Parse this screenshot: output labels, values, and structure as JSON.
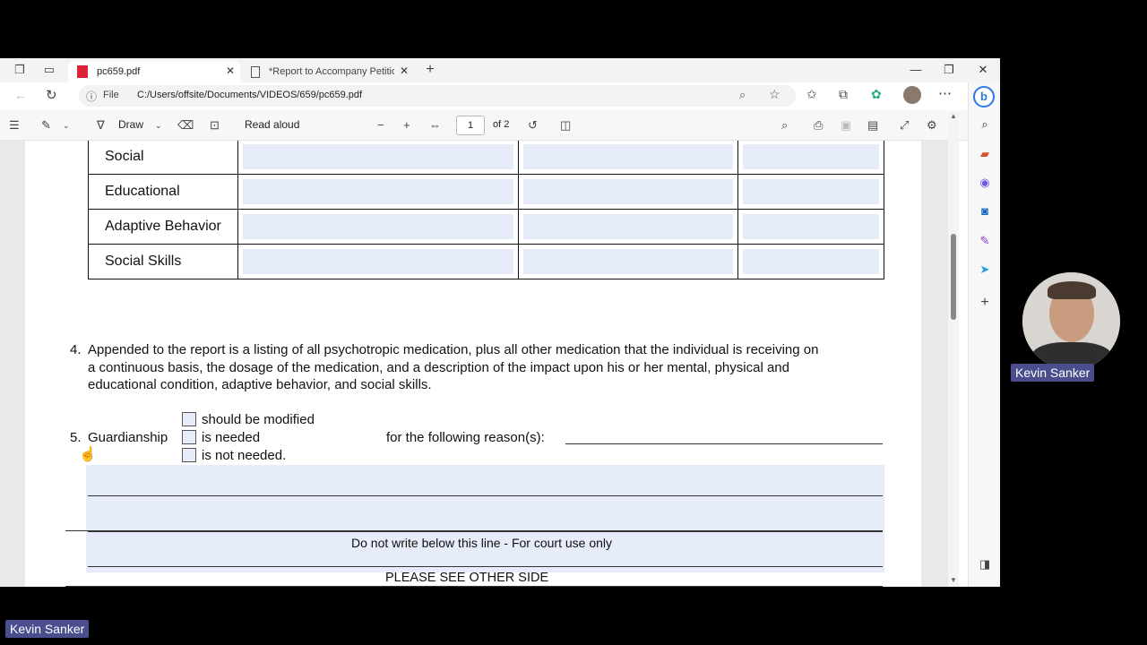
{
  "tabs": [
    {
      "title": "pc659.pdf",
      "active": true
    },
    {
      "title": "*Report to Accompany Petition t",
      "active": false
    }
  ],
  "address": {
    "scheme_label": "File",
    "url": "C:/Users/offsite/Documents/VIDEOS/659/pc659.pdf"
  },
  "pdf_toolbar": {
    "draw_label": "Draw",
    "read_aloud_label": "Read aloud",
    "page_current": "1",
    "page_total": "of 2"
  },
  "table_rows": [
    {
      "label": "Social"
    },
    {
      "label": "Educational"
    },
    {
      "label": "Adaptive Behavior"
    },
    {
      "label": "Social Skills"
    }
  ],
  "document": {
    "item4_number": "4.",
    "item4_lines": [
      "Appended to the report is a listing of all psychotropic medication, plus all other medication that the individual is receiving on",
      "a continuous basis, the dosage of the medication, and a description of the impact upon his or her mental, physical and",
      "educational condition, adaptive behavior, and social skills."
    ],
    "item5_number": "5.",
    "item5_label": "Guardianship",
    "options": [
      "should be modified",
      "is needed",
      "is not needed."
    ],
    "reason_label": "for the following reason(s):",
    "see_other_side": "PLEASE SEE OTHER SIDE",
    "court_use": "Do not write below this line - For court use only"
  },
  "participant": {
    "name_tile": "Kevin Sanker",
    "name_bottom": "Kevin Sanker"
  }
}
